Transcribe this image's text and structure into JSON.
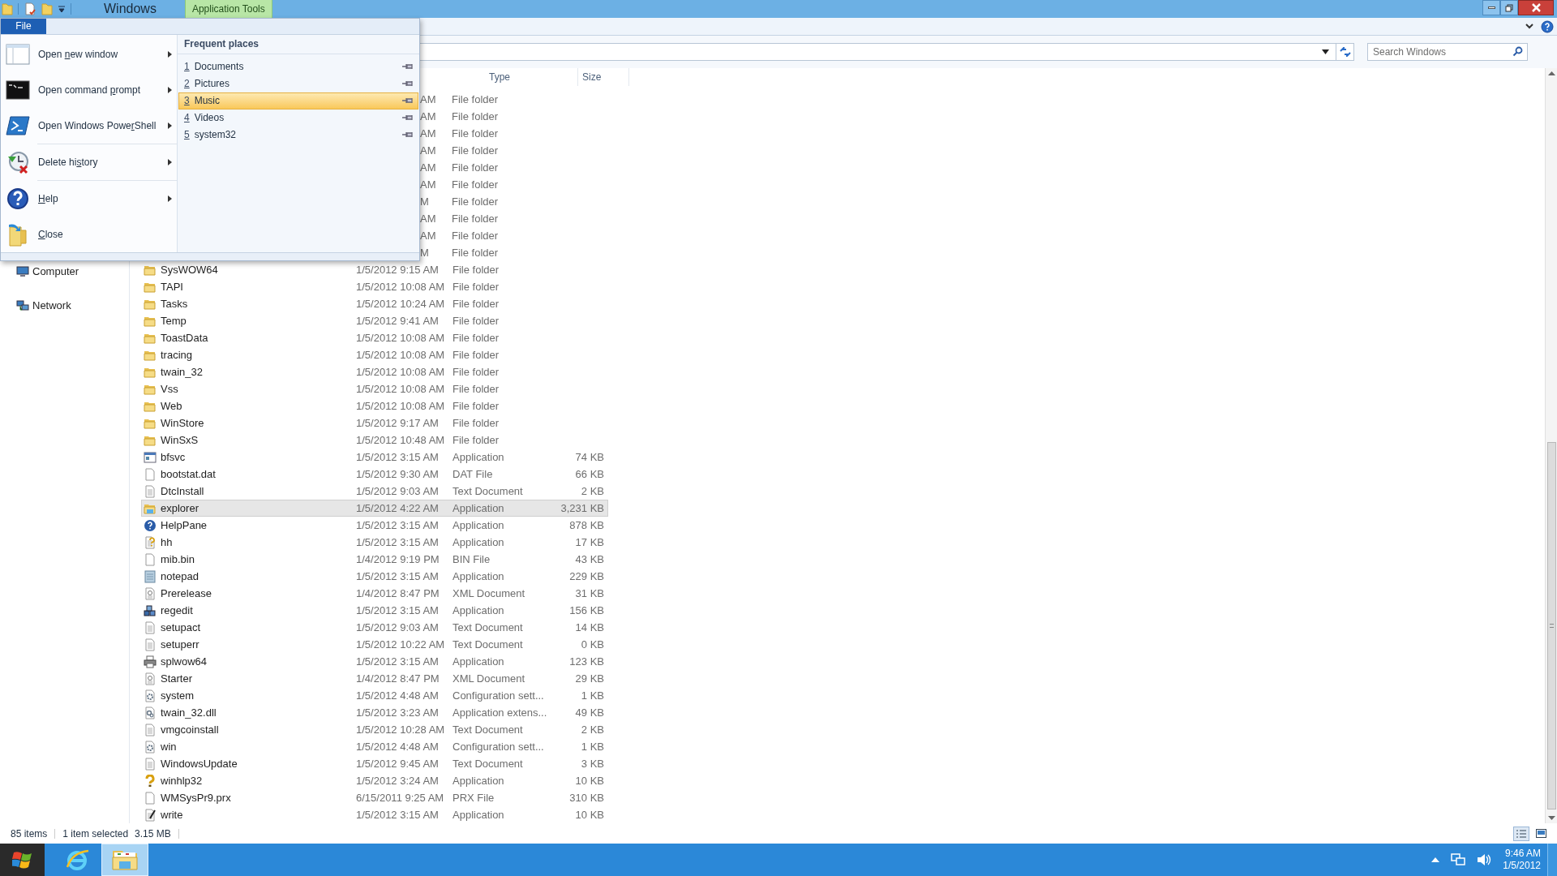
{
  "title_bar": {
    "title": "Windows",
    "context_tab": "Application Tools"
  },
  "search": {
    "placeholder": "Search Windows"
  },
  "file_menu": {
    "tab": "File",
    "commands": [
      {
        "before": "Open ",
        "key": "n",
        "after": "ew window",
        "has_submenu": true,
        "kind": "window"
      },
      {
        "before": "Open command ",
        "key": "p",
        "after": "rompt",
        "has_submenu": true,
        "kind": "console"
      },
      {
        "before": "Open Windows Powe",
        "key": "r",
        "after": "Shell",
        "has_submenu": true,
        "kind": "shell"
      },
      {
        "before": "Delete hi",
        "key": "s",
        "after": "tory",
        "has_submenu": true,
        "kind": "history"
      },
      {
        "key": "H",
        "after": "elp",
        "has_submenu": true,
        "kind": "help"
      },
      {
        "key": "C",
        "after": "lose",
        "has_submenu": false,
        "kind": "close"
      }
    ],
    "frequent_heading": "Frequent places",
    "places": [
      {
        "number": "1",
        "label": "Documents",
        "selected": false
      },
      {
        "number": "2",
        "label": "Pictures",
        "selected": false
      },
      {
        "number": "3",
        "label": "Music",
        "selected": true
      },
      {
        "number": "4",
        "label": "Videos",
        "selected": false
      },
      {
        "number": "5",
        "label": "system32",
        "selected": false
      }
    ]
  },
  "navigation": [
    {
      "label": "Computer",
      "kind": "computer"
    },
    {
      "label": "Network",
      "kind": "network"
    }
  ],
  "file_list": {
    "columns": [
      "Type",
      "Size"
    ],
    "rows": [
      {
        "kind": "covered",
        "date": "AM",
        "type": "File folder"
      },
      {
        "kind": "covered",
        "date": "AM",
        "type": "File folder"
      },
      {
        "kind": "covered",
        "date": "AM",
        "type": "File folder"
      },
      {
        "kind": "covered",
        "date": "AM",
        "type": "File folder"
      },
      {
        "kind": "covered",
        "date": "AM",
        "type": "File folder"
      },
      {
        "kind": "covered",
        "date": "AM",
        "type": "File folder"
      },
      {
        "kind": "covered",
        "date": "M",
        "type": "File folder"
      },
      {
        "kind": "covered",
        "date": "AM",
        "type": "File folder"
      },
      {
        "kind": "covered",
        "date": "AM",
        "type": "File folder"
      },
      {
        "kind": "covered",
        "date": "M",
        "type": "File folder"
      },
      {
        "kind": "folder",
        "name": "SysWOW64",
        "date": "1/5/2012 9:15 AM",
        "type": "File folder",
        "selected": false
      },
      {
        "kind": "folder",
        "name": "TAPI",
        "date": "1/5/2012 10:08 AM",
        "type": "File folder",
        "selected": false
      },
      {
        "kind": "folder",
        "name": "Tasks",
        "date": "1/5/2012 10:24 AM",
        "type": "File folder",
        "selected": false
      },
      {
        "kind": "folder",
        "name": "Temp",
        "date": "1/5/2012 9:41 AM",
        "type": "File folder",
        "selected": false
      },
      {
        "kind": "folder",
        "name": "ToastData",
        "date": "1/5/2012 10:08 AM",
        "type": "File folder",
        "selected": false
      },
      {
        "kind": "folder",
        "name": "tracing",
        "date": "1/5/2012 10:08 AM",
        "type": "File folder",
        "selected": false
      },
      {
        "kind": "folder",
        "name": "twain_32",
        "date": "1/5/2012 10:08 AM",
        "type": "File folder",
        "selected": false
      },
      {
        "kind": "folder",
        "name": "Vss",
        "date": "1/5/2012 10:08 AM",
        "type": "File folder",
        "selected": false
      },
      {
        "kind": "folder",
        "name": "Web",
        "date": "1/5/2012 10:08 AM",
        "type": "File folder",
        "selected": false
      },
      {
        "kind": "folder",
        "name": "WinStore",
        "date": "1/5/2012 9:17 AM",
        "type": "File folder",
        "selected": false
      },
      {
        "kind": "folder",
        "name": "WinSxS",
        "date": "1/5/2012 10:48 AM",
        "type": "File folder",
        "selected": false
      },
      {
        "kind": "app",
        "name": "bfsvc",
        "date": "1/5/2012 3:15 AM",
        "type": "Application",
        "size": "74 KB",
        "selected": false
      },
      {
        "kind": "blank",
        "name": "bootstat.dat",
        "date": "1/5/2012 9:30 AM",
        "type": "DAT File",
        "size": "66 KB",
        "selected": false
      },
      {
        "kind": "text",
        "name": "DtcInstall",
        "date": "1/5/2012 9:03 AM",
        "type": "Text Document",
        "size": "2 KB",
        "selected": false
      },
      {
        "kind": "explorer",
        "name": "explorer",
        "date": "1/5/2012 4:22 AM",
        "type": "Application",
        "size": "3,231 KB",
        "selected": true
      },
      {
        "kind": "help",
        "name": "HelpPane",
        "date": "1/5/2012 3:15 AM",
        "type": "Application",
        "size": "878 KB",
        "selected": false
      },
      {
        "kind": "hh",
        "name": "hh",
        "date": "1/5/2012 3:15 AM",
        "type": "Application",
        "size": "17 KB",
        "selected": false
      },
      {
        "kind": "blank",
        "name": "mib.bin",
        "date": "1/4/2012 9:19 PM",
        "type": "BIN File",
        "size": "43 KB",
        "selected": false
      },
      {
        "kind": "notepad",
        "name": "notepad",
        "date": "1/5/2012 3:15 AM",
        "type": "Application",
        "size": "229 KB",
        "selected": false
      },
      {
        "kind": "xml",
        "name": "Prerelease",
        "date": "1/4/2012 8:47 PM",
        "type": "XML Document",
        "size": "31 KB",
        "selected": false
      },
      {
        "kind": "regedit",
        "name": "regedit",
        "date": "1/5/2012 3:15 AM",
        "type": "Application",
        "size": "156 KB",
        "selected": false
      },
      {
        "kind": "text",
        "name": "setupact",
        "date": "1/5/2012 9:03 AM",
        "type": "Text Document",
        "size": "14 KB",
        "selected": false
      },
      {
        "kind": "text",
        "name": "setuperr",
        "date": "1/5/2012 10:22 AM",
        "type": "Text Document",
        "size": "0 KB",
        "selected": false
      },
      {
        "kind": "printer",
        "name": "splwow64",
        "date": "1/5/2012 3:15 AM",
        "type": "Application",
        "size": "123 KB",
        "selected": false
      },
      {
        "kind": "xml",
        "name": "Starter",
        "date": "1/4/2012 8:47 PM",
        "type": "XML Document",
        "size": "29 KB",
        "selected": false
      },
      {
        "kind": "config",
        "name": "system",
        "date": "1/5/2012 4:48 AM",
        "type": "Configuration sett...",
        "size": "1 KB",
        "selected": false
      },
      {
        "kind": "dll",
        "name": "twain_32.dll",
        "date": "1/5/2012 3:23 AM",
        "type": "Application extens...",
        "size": "49 KB",
        "selected": false
      },
      {
        "kind": "text",
        "name": "vmgcoinstall",
        "date": "1/5/2012 10:28 AM",
        "type": "Text Document",
        "size": "2 KB",
        "selected": false
      },
      {
        "kind": "config",
        "name": "win",
        "date": "1/5/2012 4:48 AM",
        "type": "Configuration sett...",
        "size": "1 KB",
        "selected": false
      },
      {
        "kind": "text",
        "name": "WindowsUpdate",
        "date": "1/5/2012 9:45 AM",
        "type": "Text Document",
        "size": "3 KB",
        "selected": false
      },
      {
        "kind": "winhelp",
        "name": "winhlp32",
        "date": "1/5/2012 3:24 AM",
        "type": "Application",
        "size": "10 KB",
        "selected": false
      },
      {
        "kind": "blank",
        "name": "WMSysPr9.prx",
        "date": "6/15/2011 9:25 AM",
        "type": "PRX File",
        "size": "310 KB",
        "selected": false
      },
      {
        "kind": "write",
        "name": "write",
        "date": "1/5/2012 3:15 AM",
        "type": "Application",
        "size": "10 KB",
        "selected": false
      }
    ]
  },
  "status_bar": {
    "item_count": "85 items",
    "selection": "1 item selected",
    "selection_size": "3.15 MB"
  },
  "taskbar": {
    "apps": [
      {
        "kind": "start",
        "selected": false
      },
      {
        "kind": "browser",
        "selected": false
      },
      {
        "kind": "explorer",
        "selected": true
      }
    ],
    "clock": {
      "time": "9:46 AM",
      "date": "1/5/2012"
    }
  }
}
